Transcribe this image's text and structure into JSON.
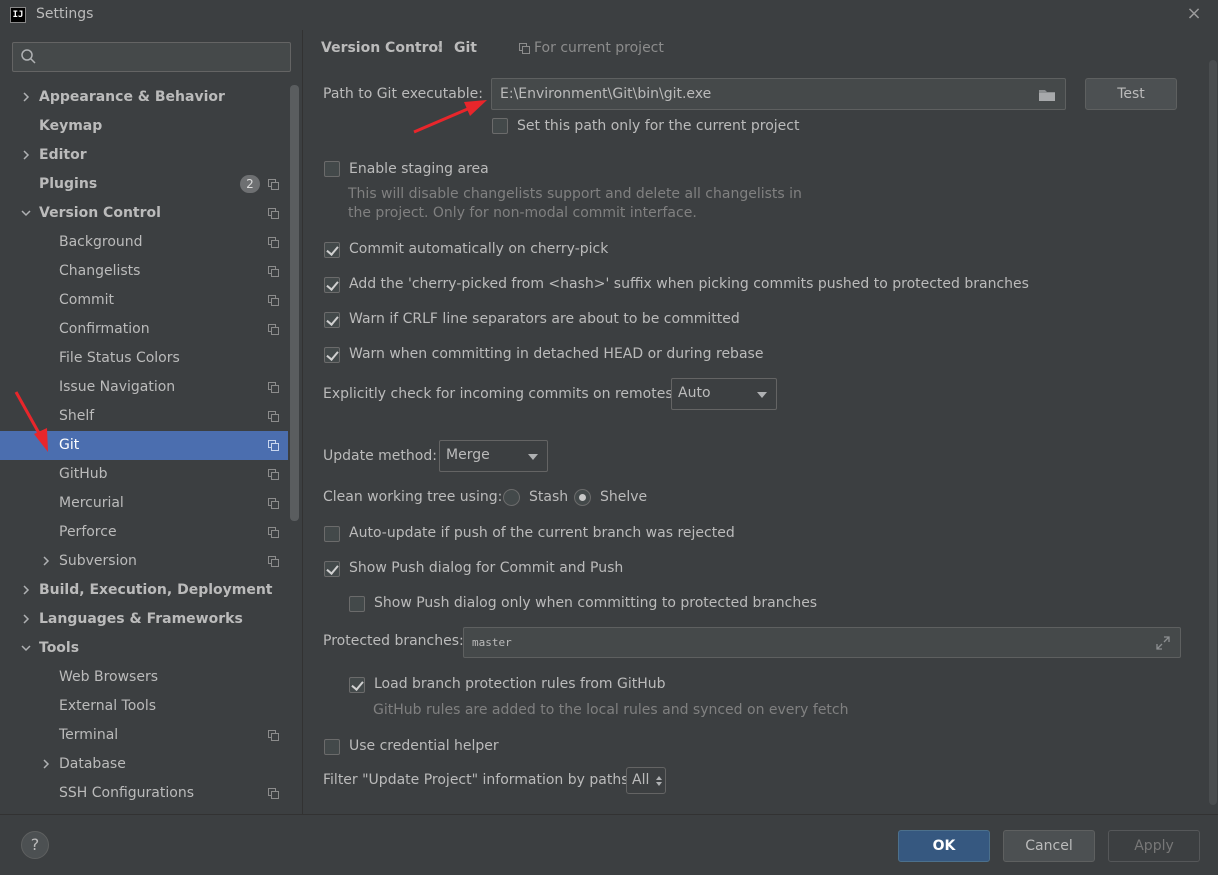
{
  "window": {
    "title": "Settings",
    "app_icon": "intellij-icon",
    "close_label": "×"
  },
  "search": {
    "placeholder": "",
    "value": ""
  },
  "tree": [
    {
      "label": "Appearance & Behavior",
      "bold": true,
      "indent": 0,
      "arrow": "right",
      "project": false
    },
    {
      "label": "Keymap",
      "bold": true,
      "indent": 0,
      "arrow": "",
      "project": false
    },
    {
      "label": "Editor",
      "bold": true,
      "indent": 0,
      "arrow": "right",
      "project": false
    },
    {
      "label": "Plugins",
      "bold": true,
      "indent": 0,
      "arrow": "",
      "project": true,
      "badge": "2"
    },
    {
      "label": "Version Control",
      "bold": true,
      "indent": 0,
      "arrow": "down",
      "project": true
    },
    {
      "label": "Background",
      "bold": false,
      "indent": 1,
      "arrow": "",
      "project": true
    },
    {
      "label": "Changelists",
      "bold": false,
      "indent": 1,
      "arrow": "",
      "project": true
    },
    {
      "label": "Commit",
      "bold": false,
      "indent": 1,
      "arrow": "",
      "project": true
    },
    {
      "label": "Confirmation",
      "bold": false,
      "indent": 1,
      "arrow": "",
      "project": true
    },
    {
      "label": "File Status Colors",
      "bold": false,
      "indent": 1,
      "arrow": "",
      "project": false
    },
    {
      "label": "Issue Navigation",
      "bold": false,
      "indent": 1,
      "arrow": "",
      "project": true
    },
    {
      "label": "Shelf",
      "bold": false,
      "indent": 1,
      "arrow": "",
      "project": true
    },
    {
      "label": "Git",
      "bold": false,
      "indent": 1,
      "arrow": "",
      "project": true,
      "selected": true
    },
    {
      "label": "GitHub",
      "bold": false,
      "indent": 1,
      "arrow": "",
      "project": true
    },
    {
      "label": "Mercurial",
      "bold": false,
      "indent": 1,
      "arrow": "",
      "project": true
    },
    {
      "label": "Perforce",
      "bold": false,
      "indent": 1,
      "arrow": "",
      "project": true
    },
    {
      "label": "Subversion",
      "bold": false,
      "indent": 1,
      "arrow": "right",
      "project": true
    },
    {
      "label": "Build, Execution, Deployment",
      "bold": true,
      "indent": 0,
      "arrow": "right",
      "project": false
    },
    {
      "label": "Languages & Frameworks",
      "bold": true,
      "indent": 0,
      "arrow": "right",
      "project": false
    },
    {
      "label": "Tools",
      "bold": true,
      "indent": 0,
      "arrow": "down",
      "project": false
    },
    {
      "label": "Web Browsers",
      "bold": false,
      "indent": 1,
      "arrow": "",
      "project": false
    },
    {
      "label": "External Tools",
      "bold": false,
      "indent": 1,
      "arrow": "",
      "project": false
    },
    {
      "label": "Terminal",
      "bold": false,
      "indent": 1,
      "arrow": "",
      "project": true
    },
    {
      "label": "Database",
      "bold": false,
      "indent": 1,
      "arrow": "right",
      "project": false
    },
    {
      "label": "SSH Configurations",
      "bold": false,
      "indent": 1,
      "arrow": "",
      "project": true
    }
  ],
  "breadcrumb": {
    "parent": "Version Control",
    "separator": "›",
    "current": "Git",
    "scope": "For current project"
  },
  "git": {
    "path_label": "Path to Git executable:",
    "path_value": "E:\\Environment\\Git\\bin\\git.exe",
    "test_button": "Test",
    "path_current_project": {
      "label": "Set this path only for the current project",
      "checked": false
    },
    "staging": {
      "label": "Enable staging area",
      "checked": false
    },
    "staging_hint_1": "This will disable changelists support and delete all changelists in",
    "staging_hint_2": "the project. Only for non-modal commit interface.",
    "cherry_commit": {
      "label": "Commit automatically on cherry-pick",
      "checked": true
    },
    "cherry_suffix": {
      "label": "Add the 'cherry-picked from <hash>' suffix when picking commits pushed to protected branches",
      "checked": true
    },
    "crlf": {
      "label": "Warn if CRLF line separators are about to be committed",
      "checked": true
    },
    "detached": {
      "label": "Warn when committing in detached HEAD or during rebase",
      "checked": true
    },
    "incoming_label": "Explicitly check for incoming commits on remotes:",
    "incoming_value": "Auto",
    "update_label": "Update method:",
    "update_value": "Merge",
    "clean_label": "Clean working tree using:",
    "clean_options": [
      {
        "label": "Stash",
        "selected": false
      },
      {
        "label": "Shelve",
        "selected": true
      }
    ],
    "auto_update": {
      "label": "Auto-update if push of the current branch was rejected",
      "checked": false
    },
    "push_dialog": {
      "label": "Show Push dialog for Commit and Push",
      "checked": true
    },
    "push_dialog_protected": {
      "label": "Show Push dialog only when committing to protected branches",
      "checked": false
    },
    "protected_label": "Protected branches:",
    "protected_value": "master",
    "load_rules": {
      "label": "Load branch protection rules from GitHub",
      "checked": true
    },
    "load_rules_hint": "GitHub rules are added to the local rules and synced on every fetch",
    "credential": {
      "label": "Use credential helper",
      "checked": false
    },
    "filter_label": "Filter \"Update Project\" information by paths:",
    "filter_value": "All"
  },
  "footer": {
    "help": "?",
    "ok": "OK",
    "cancel": "Cancel",
    "apply": "Apply"
  },
  "colors": {
    "selection": "#4b6eaf",
    "annotation_arrow": "#e8262b",
    "ok_button": "#365880"
  }
}
